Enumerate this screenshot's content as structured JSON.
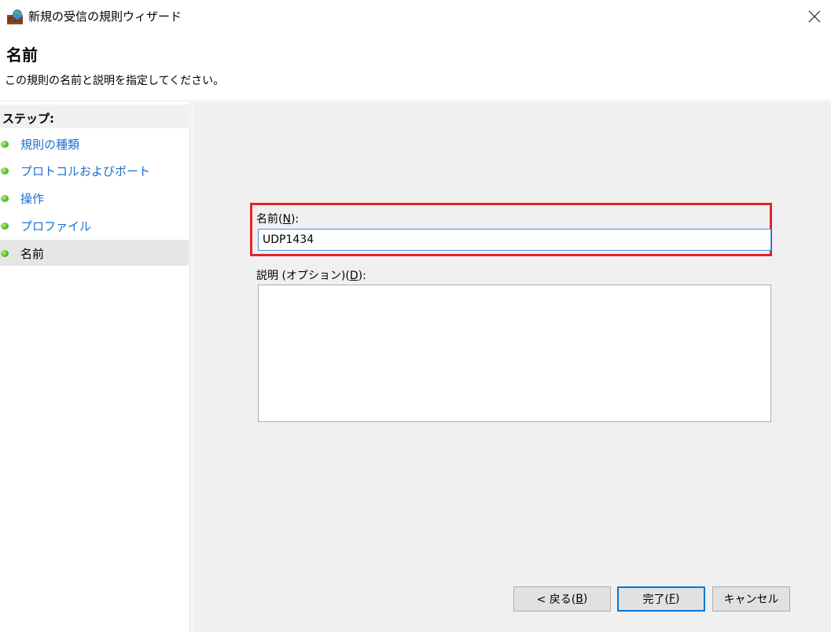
{
  "window": {
    "title": "新規の受信の規則ウィザード",
    "app_icon": "firewall-icon",
    "close_icon": "close-icon"
  },
  "header": {
    "title": "名前",
    "subtitle": "この規則の名前と説明を指定してください。"
  },
  "sidebar": {
    "steps_label": "ステップ:",
    "items": [
      {
        "label": "規則の種類",
        "active": false
      },
      {
        "label": "プロトコルおよびポート",
        "active": false
      },
      {
        "label": "操作",
        "active": false
      },
      {
        "label": "プロファイル",
        "active": false
      },
      {
        "label": "名前",
        "active": true
      }
    ]
  },
  "form": {
    "name_label_prefix": "名前(",
    "name_label_key": "N",
    "name_label_suffix": "):",
    "name_value": "UDP1434",
    "desc_label_prefix": "説明 (オプション)(",
    "desc_label_key": "D",
    "desc_label_suffix": "):",
    "desc_value": ""
  },
  "buttons": {
    "back_prefix": "< 戻る(",
    "back_key": "B",
    "back_suffix": ")",
    "finish_prefix": "完了(",
    "finish_key": "F",
    "finish_suffix": ")",
    "cancel": "キャンセル"
  },
  "colors": {
    "highlight": "#e3242b",
    "link": "#1a6fd1",
    "accent": "#0078d7"
  }
}
